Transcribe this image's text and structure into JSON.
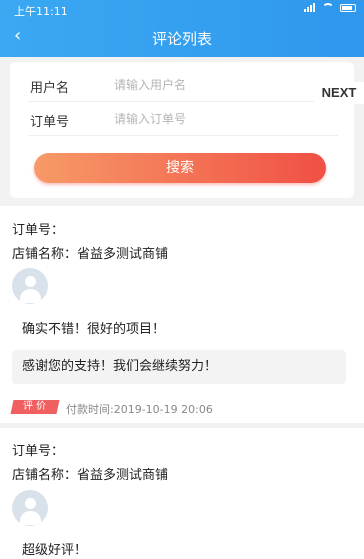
{
  "status_bar": {
    "time": "上午11:11"
  },
  "nav": {
    "back_icon": "‹",
    "title": "评论列表"
  },
  "search": {
    "username_label": "用户名",
    "username_placeholder": "请输入用户名",
    "order_label": "订单号",
    "order_placeholder": "请输入订单号",
    "button_label": "搜索"
  },
  "overlay": {
    "next_label": "NEXT"
  },
  "colors": {
    "nav": "#2f97ec",
    "button_from": "#f79a67",
    "button_to": "#f05045",
    "tag": "#f06060"
  },
  "reviews": [
    {
      "order_label": "订单号：",
      "shop": "店铺名称：省益多测试商铺",
      "comment": "确实不错！很好的项目！",
      "reply": "感谢您的支持！我们会继续努力！",
      "tag": "评 价",
      "pay_time": "付款时间:2019-10-19 20:06"
    },
    {
      "order_label": "订单号：",
      "shop": "店铺名称：省益多测试商铺",
      "comment": "超级好评！"
    }
  ]
}
